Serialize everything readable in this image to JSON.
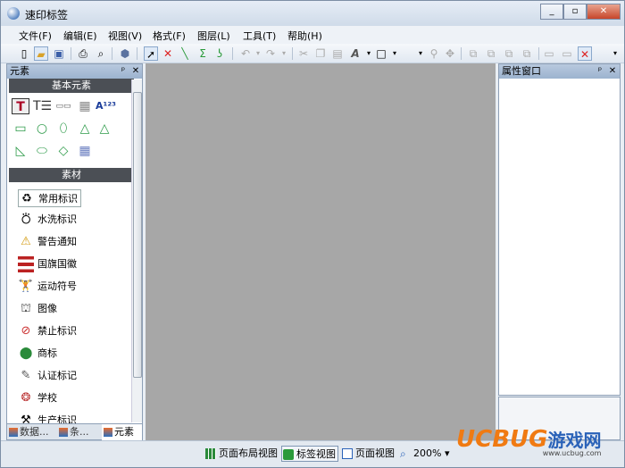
{
  "window": {
    "title": "速印标签"
  },
  "window_buttons": {
    "minimize": "_",
    "restore": "▫",
    "close": "✕"
  },
  "menu": [
    "文件(F)",
    "编辑(E)",
    "视图(V)",
    "格式(F)",
    "图层(L)",
    "工具(T)",
    "帮助(H)"
  ],
  "elements_panel": {
    "title": "元素",
    "pin": "ᵖ",
    "close": "✕",
    "section_basic": "基本元素",
    "section_material": "素材",
    "materials": [
      "常用标识",
      "水洗标识",
      "警告通知",
      "国旗国徽",
      "运动符号",
      "图像",
      "禁止标识",
      "商标",
      "认证标记",
      "学校",
      "生产标识"
    ]
  },
  "bottom_tabs": [
    "数据...",
    "条...",
    "元素"
  ],
  "property_panel": {
    "title": "属性窗口",
    "pin": "ᵖ",
    "close": "✕"
  },
  "statusbar": {
    "layout_view": "页面布局视图",
    "label_view": "标签视图",
    "page_view": "页面视图",
    "zoom": "200%"
  },
  "watermark": {
    "brand": "UCBUG",
    "suffix": "游戏网",
    "url": "www.ucbug.com"
  },
  "colors": {
    "canvas": "#a7a7a7",
    "watermark_orange": "#f07a12",
    "watermark_blue": "#2a62b8",
    "shape_green": "#2e9b4a"
  }
}
